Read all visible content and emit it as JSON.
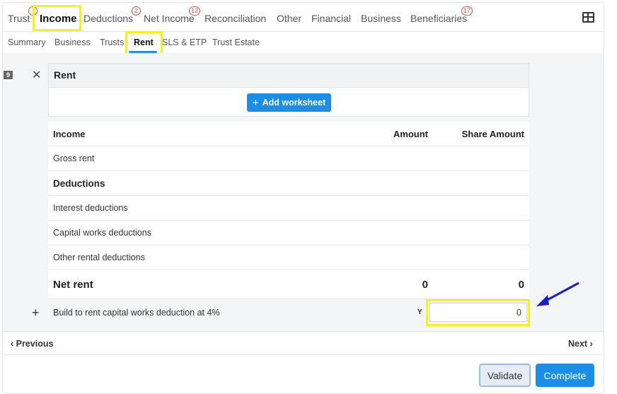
{
  "top_tabs": [
    {
      "label": "Trust",
      "badge": ""
    },
    {
      "label": "Income",
      "badge": ""
    },
    {
      "label": "Deductions",
      "badge": "2"
    },
    {
      "label": "Net Income",
      "badge": "12"
    },
    {
      "label": "Reconciliation",
      "badge": ""
    },
    {
      "label": "Other",
      "badge": ""
    },
    {
      "label": "Financial",
      "badge": ""
    },
    {
      "label": "Business",
      "badge": ""
    },
    {
      "label": "Beneficiaries",
      "badge": "17"
    }
  ],
  "active_top_tab": "Income",
  "sub_tabs": [
    {
      "label": "Summary"
    },
    {
      "label": "Business"
    },
    {
      "label": "Trusts"
    },
    {
      "label": "Rent"
    },
    {
      "label": "SLS & ETP"
    },
    {
      "label": "Trust Estate"
    }
  ],
  "active_sub_tab": "Rent",
  "item_number": "9",
  "card": {
    "title": "Rent",
    "add_worksheet_label": "Add worksheet"
  },
  "table": {
    "headers": {
      "label": "Income",
      "amount": "Amount",
      "share": "Share Amount"
    },
    "rows": [
      {
        "label": "Gross rent",
        "amount": "",
        "share": ""
      },
      {
        "label": "Deductions",
        "amount": "",
        "share": ""
      },
      {
        "label": "Interest deductions",
        "amount": "",
        "share": ""
      },
      {
        "label": "Capital works deductions",
        "amount": "",
        "share": ""
      },
      {
        "label": "Other rental deductions",
        "amount": "",
        "share": ""
      }
    ],
    "net": {
      "label": "Net rent",
      "amount": "0",
      "share": "0"
    }
  },
  "build_to_rent": {
    "label": "Build to rent capital works deduction at 4%",
    "code": "Y",
    "value": "0"
  },
  "nav": {
    "previous": "Previous",
    "next": "Next"
  },
  "buttons": {
    "validate": "Validate",
    "complete": "Complete"
  },
  "colors": {
    "accent": "#1d8ee6",
    "highlight": "#f6f21b",
    "annotation_arrow": "#1a1fc7",
    "badge": "#d9534f"
  }
}
